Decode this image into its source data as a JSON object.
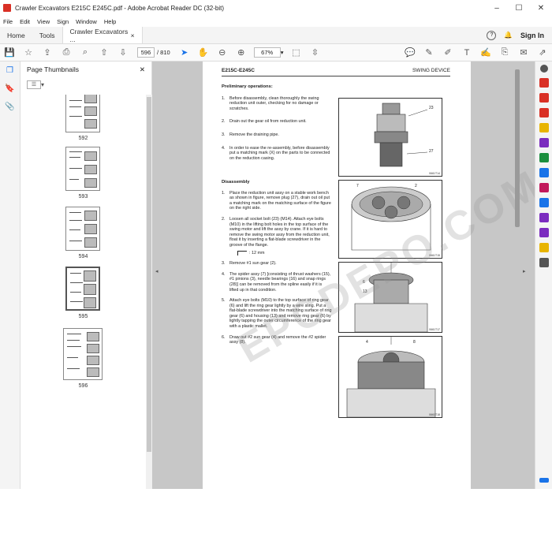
{
  "window": {
    "title": "Crawler Excavators E215C E245C.pdf - Adobe Acrobat Reader DC (32-bit)"
  },
  "menu": [
    "File",
    "Edit",
    "View",
    "Sign",
    "Window",
    "Help"
  ],
  "tabs": {
    "home": "Home",
    "tools": "Tools",
    "doc": "Crawler Excavators ...",
    "close": "×",
    "signin": "Sign In"
  },
  "toolbar": {
    "page_current": "596",
    "page_total": "/ 810",
    "zoom": "67%"
  },
  "thumbnails": {
    "title": "Page Thumbnails",
    "close": "✕",
    "pages": [
      "592",
      "593",
      "594",
      "595",
      "596"
    ],
    "current": "595"
  },
  "page": {
    "header_left": "E215C-E245C",
    "header_right": "SWING DEVICE",
    "prelim_title": "Preliminary operations:",
    "prelim_steps": [
      {
        "n": "1.",
        "text": "Before disassembly, clean thoroughly the swing reduction unit outer, checking for no damage or scratches."
      },
      {
        "n": "2.",
        "text": "Drain out the gear oil from reduction unit."
      },
      {
        "n": "3.",
        "text": "Remove the draining pipe."
      },
      {
        "n": "4.",
        "text": "In order to ease the re-assembly, before disassembly put a matching mark (X) on the parts to be connected on the reduction casing."
      }
    ],
    "disassembly_title": "Disassembly",
    "dis_steps": [
      {
        "n": "1.",
        "text": "Place the reduction unit assy on a stable work bench as shown in figure, remove plug (27), drain out oil put a matching mark on the matching surface of the figure on the right side."
      },
      {
        "n": "2.",
        "text": "Loosen all socket bolt (23) (M14). Attach eye bolts (M10) in the lifting bolt holes in the top surface of the swing motor and lift the assy by crane. If it is hard to remove the swing motor assy from the reduction unit, float it by inserting a flat-blade screwdriver in the groove of the flange."
      },
      {
        "n": "",
        "text": ": 12 mm"
      },
      {
        "n": "3.",
        "text": "Remove #1 sun gear (2)."
      },
      {
        "n": "4.",
        "text": "The spider assy (7) [consisting of thrust washers (15), #1 pinions (3), needle bearings (16) and snap rings (28)] can be removed from the spline easily if it is lifted up in that condition."
      },
      {
        "n": "5.",
        "text": "Attach eye bolts (M10) to the top surface of ring gear (6) and lift the ring gear lightly by a wire sling. Put a flat-blade screwdriver into the matching surface of ring gear (6) and housing (13) and remove ring gear (6) by lightly tapping the outer circumference of the ring gear with a plastic mallet."
      },
      {
        "n": "6.",
        "text": "Draw out #2 sun gear (4) and remove the #2 spider assy (8)."
      }
    ],
    "figures": [
      {
        "code": "0661T14",
        "labels": [
          "23",
          "27"
        ]
      },
      {
        "code": "0661T15",
        "labels": [
          "7",
          "2"
        ]
      },
      {
        "code": "0661T16",
        "labels": []
      },
      {
        "code": "0661T17",
        "labels": [
          "6",
          "13"
        ]
      },
      {
        "code": "0661T18",
        "labels": [
          "4",
          "8"
        ]
      }
    ],
    "watermark": "EPCDEPO.COM"
  },
  "colors": {
    "accent": "#1a73e8",
    "chrome": "#f4f4f4",
    "viewer_bg": "#c7c7c7"
  }
}
